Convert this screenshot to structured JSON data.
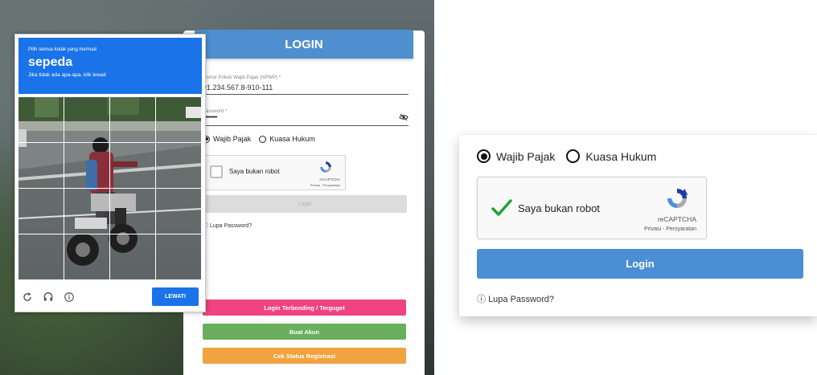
{
  "login_form": {
    "title": "LOGIN",
    "npwp_label": "Nomor Pokok Wajib Pajak (NPWP) *",
    "npwp_value": "91.234.567.8-910-111",
    "password_label": "Password *",
    "password_value": "••••••••••••",
    "radio_options": [
      "Wajib Pajak",
      "Kuasa Hukum"
    ],
    "selected_radio": "Wajib Pajak",
    "recaptcha_label": "Saya bukan robot",
    "recaptcha_brand": "reCAPTCHA",
    "recaptcha_terms": "Privasi - Persyaratan",
    "login_button": "Login",
    "forgot_password": "Lupa Password?",
    "buttons": {
      "blocked": "Login Terbending / Terguget",
      "create_account": "Buat Akun",
      "check_status": "Cek Status Registrasi"
    },
    "colors": {
      "header": "#4f8fcf",
      "blocked": "#f0437f",
      "create_account": "#6aaf5e",
      "check_status": "#f0a340"
    }
  },
  "image_challenge": {
    "instruction": "Pilih semua kotak yang memuat",
    "target_object": "sepeda",
    "subtext": "Jika tidak ada apa-apa, klik lewati",
    "grid_size": 4,
    "icons": [
      "reload-icon",
      "audio-icon",
      "info-icon"
    ],
    "skip_button": "LEWATI",
    "accent_color": "#1a73e8"
  },
  "zoomed_panel": {
    "radio_options": [
      "Wajib Pajak",
      "Kuasa Hukum"
    ],
    "selected_radio": "Wajib Pajak",
    "recaptcha_label": "Saya bukan robot",
    "recaptcha_checked": true,
    "recaptcha_brand": "reCAPTCHA",
    "recaptcha_terms": "Privasi - Persyaratan",
    "login_button": "Login",
    "forgot_password": "Lupa Password?"
  }
}
